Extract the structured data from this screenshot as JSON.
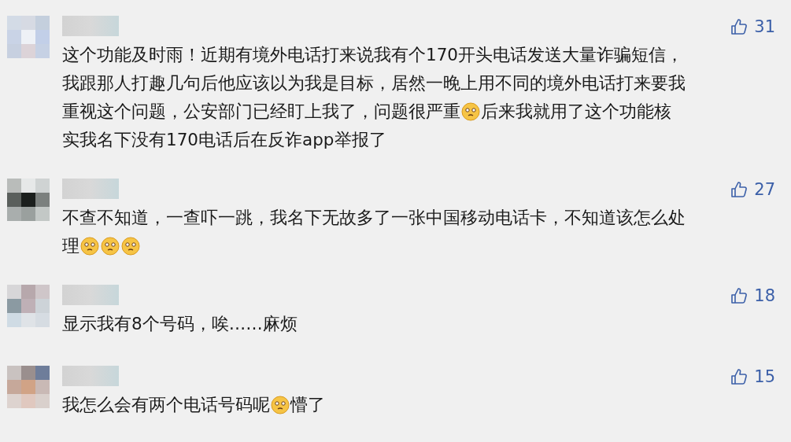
{
  "comments": [
    {
      "likes": "31",
      "lines": [
        [
          {
            "kind": "text",
            "text": "这个功能及时雨！近期有境外电话打来说我有个170开头电话发送大量诈骗短信，"
          }
        ],
        [
          {
            "kind": "text",
            "text": "我跟那人打趣几句后他应该以为我是目标，居然一晚上用不同的境外电话打来要我"
          }
        ],
        [
          {
            "kind": "text",
            "text": "重视这个问题，公安部门已经盯上我了，问题很严重"
          },
          {
            "kind": "emoji"
          },
          {
            "kind": "text",
            "text": "后来我就用了这个功能核"
          }
        ],
        [
          {
            "kind": "text",
            "text": "实我名下没有170电话后在反诈app举报了"
          }
        ]
      ]
    },
    {
      "likes": "27",
      "lines": [
        [
          {
            "kind": "text",
            "text": "不查不知道，一查吓一跳，我名下无故多了一张中国移动电话卡，不知道该怎么处"
          }
        ],
        [
          {
            "kind": "text",
            "text": "理"
          },
          {
            "kind": "emoji"
          },
          {
            "kind": "emoji"
          },
          {
            "kind": "emoji"
          }
        ]
      ]
    },
    {
      "likes": "18",
      "lines": [
        [
          {
            "kind": "text",
            "text": "显示我有8个号码，唉……麻烦"
          }
        ]
      ]
    },
    {
      "likes": "15",
      "lines": [
        [
          {
            "kind": "text",
            "text": "我怎么会有两个电话号码呢"
          },
          {
            "kind": "emoji"
          },
          {
            "kind": "text",
            "text": "懵了"
          }
        ]
      ]
    }
  ]
}
